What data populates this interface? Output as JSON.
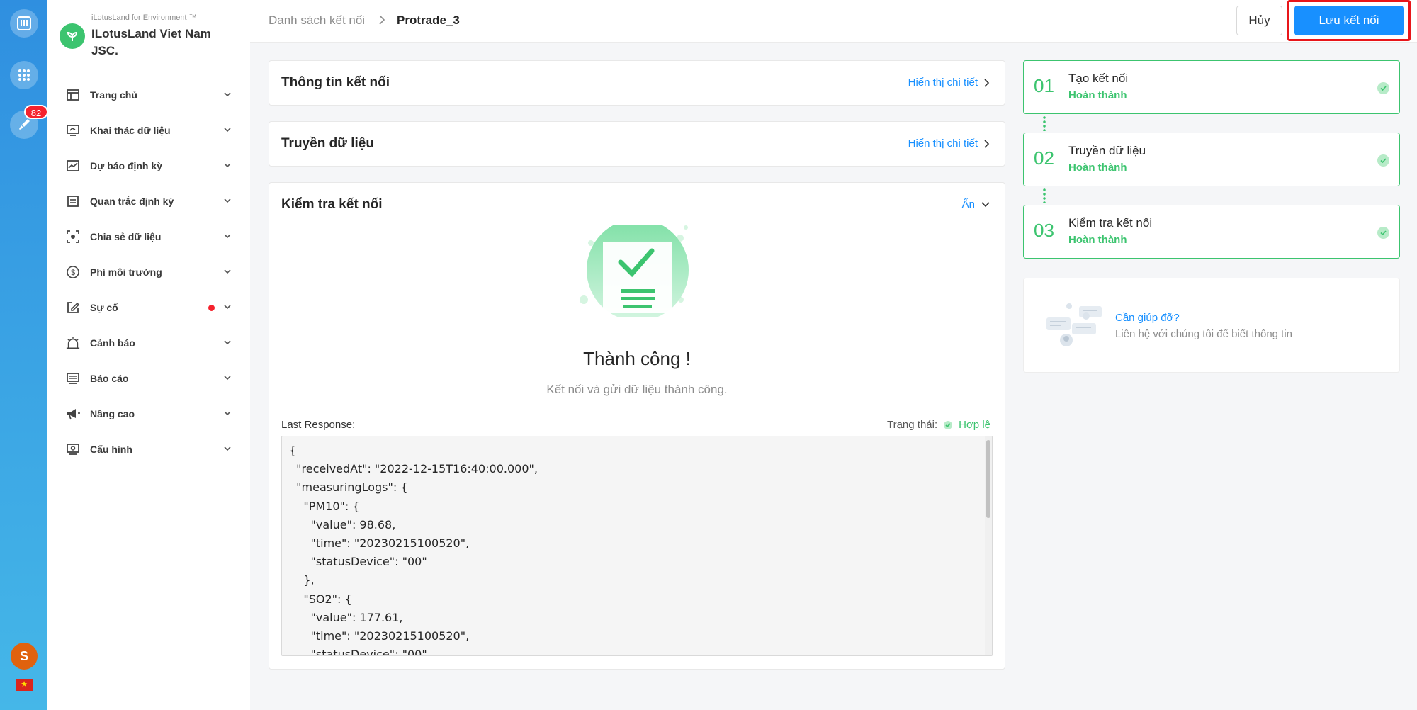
{
  "rail": {
    "notification_count": "82",
    "avatar_initial": "S",
    "language_flag": "★"
  },
  "brand": {
    "subtitle": "iLotusLand for Environment ™",
    "name": "ILotusLand Viet Nam JSC."
  },
  "sidebar": {
    "items": [
      {
        "label": "Trang chủ",
        "icon": "home-icon"
      },
      {
        "label": "Khai thác dữ liệu",
        "icon": "monitor-icon"
      },
      {
        "label": "Dự báo định kỳ",
        "icon": "chart-line-icon"
      },
      {
        "label": "Quan trắc định kỳ",
        "icon": "clipboard-icon"
      },
      {
        "label": "Chia sẻ dữ liệu",
        "icon": "share-icon"
      },
      {
        "label": "Phí môi trường",
        "icon": "dollar-icon"
      },
      {
        "label": "Sự cố",
        "icon": "edit-icon",
        "has_alert_dot": true
      },
      {
        "label": "Cảnh báo",
        "icon": "alarm-icon"
      },
      {
        "label": "Báo cáo",
        "icon": "report-icon"
      },
      {
        "label": "Nâng cao",
        "icon": "megaphone-icon"
      },
      {
        "label": "Cấu hình",
        "icon": "settings-monitor-icon"
      }
    ]
  },
  "header": {
    "breadcrumb_parent": "Danh sách kết nối",
    "breadcrumb_current": "Protrade_3",
    "cancel_label": "Hủy",
    "save_label": "Lưu kết nối"
  },
  "sections": {
    "info": {
      "title": "Thông tin kết nối",
      "link": "Hiển thị chi tiết"
    },
    "transfer": {
      "title": "Truyền dữ liệu",
      "link": "Hiển thị chi tiết"
    },
    "check": {
      "title": "Kiểm tra kết nối",
      "toggle": "Ẩn",
      "success_title": "Thành công !",
      "success_desc": "Kết nối và gửi dữ liệu thành công.",
      "last_response_label": "Last Response:",
      "status_label": "Trạng thái:",
      "status_value": "Hợp lệ",
      "response_json": "{\n  \"receivedAt\": \"2022-12-15T16:40:00.000\",\n  \"measuringLogs\": {\n    \"PM10\": {\n      \"value\": 98.68,\n      \"time\": \"20230215100520\",\n      \"statusDevice\": \"00\"\n    },\n    \"SO2\": {\n      \"value\": 177.61,\n      \"time\": \"20230215100520\",\n      \"statusDevice\": \"00\""
    }
  },
  "steps": [
    {
      "num": "01",
      "title": "Tạo kết nối",
      "status": "Hoàn thành"
    },
    {
      "num": "02",
      "title": "Truyền dữ liệu",
      "status": "Hoàn thành"
    },
    {
      "num": "03",
      "title": "Kiểm tra kết nối",
      "status": "Hoàn thành"
    }
  ],
  "help": {
    "title": "Cần giúp đỡ?",
    "desc": "Liên hệ với chúng tôi để biết thông tin"
  },
  "colors": {
    "primary": "#1890ff",
    "success": "#3cc46f",
    "danger": "#f5222d",
    "highlight_frame": "#e8161a"
  }
}
